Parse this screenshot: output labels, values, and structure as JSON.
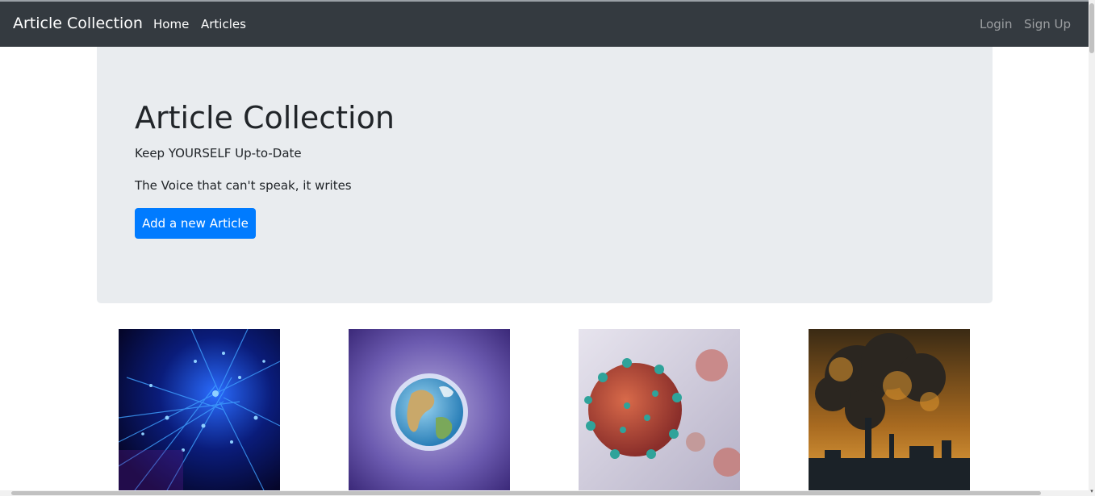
{
  "navbar": {
    "brand": "Article Collection",
    "links": [
      "Home",
      "Articles"
    ],
    "auth_links": [
      "Login",
      "Sign Up"
    ],
    "bg_color": "#343a40"
  },
  "jumbotron": {
    "title": "Article Collection",
    "lead": "Keep YOURSELF Up-to-Date",
    "subtitle": "The Voice that can't speak, it writes",
    "button_label": "Add a new Article",
    "bg_color": "#e9ecef",
    "button_color": "#007bff"
  },
  "articles": [
    {
      "image": "blue-fiber-network-image"
    },
    {
      "image": "earth-watercolor-image"
    },
    {
      "image": "coronavirus-image"
    },
    {
      "image": "factory-smoke-pollution-image"
    }
  ]
}
